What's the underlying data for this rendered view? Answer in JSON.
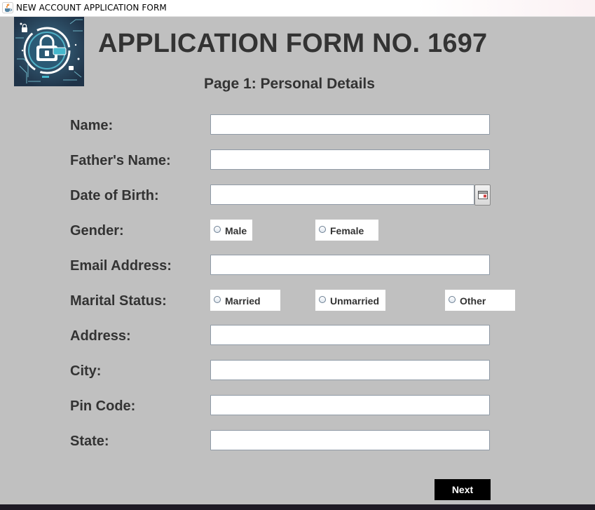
{
  "window": {
    "title": "NEW ACCOUNT APPLICATION FORM",
    "icon": "java-cup-icon"
  },
  "header": {
    "logo_icon": "padlock-shield-logo",
    "title": "APPLICATION FORM NO. 1697",
    "subtitle": "Page 1: Personal Details"
  },
  "form": {
    "name_label": "Name:",
    "name_value": "",
    "father_label": "Father's Name:",
    "father_value": "",
    "dob_label": "Date of Birth:",
    "dob_value": "",
    "dob_picker_icon": "calendar-icon",
    "gender_label": "Gender:",
    "gender_options": [
      "Male",
      "Female"
    ],
    "email_label": "Email Address:",
    "email_value": "",
    "marital_label": "Marital Status:",
    "marital_options": [
      "Married",
      "Unmarried",
      "Other"
    ],
    "address_label": "Address:",
    "address_value": "",
    "city_label": "City:",
    "city_value": "",
    "pin_label": "Pin Code:",
    "pin_value": "",
    "state_label": "State:",
    "state_value": ""
  },
  "actions": {
    "next_label": "Next"
  },
  "colors": {
    "background": "#c0c0c0",
    "text": "#333333",
    "button": "#000000",
    "button_text": "#ffffff"
  }
}
